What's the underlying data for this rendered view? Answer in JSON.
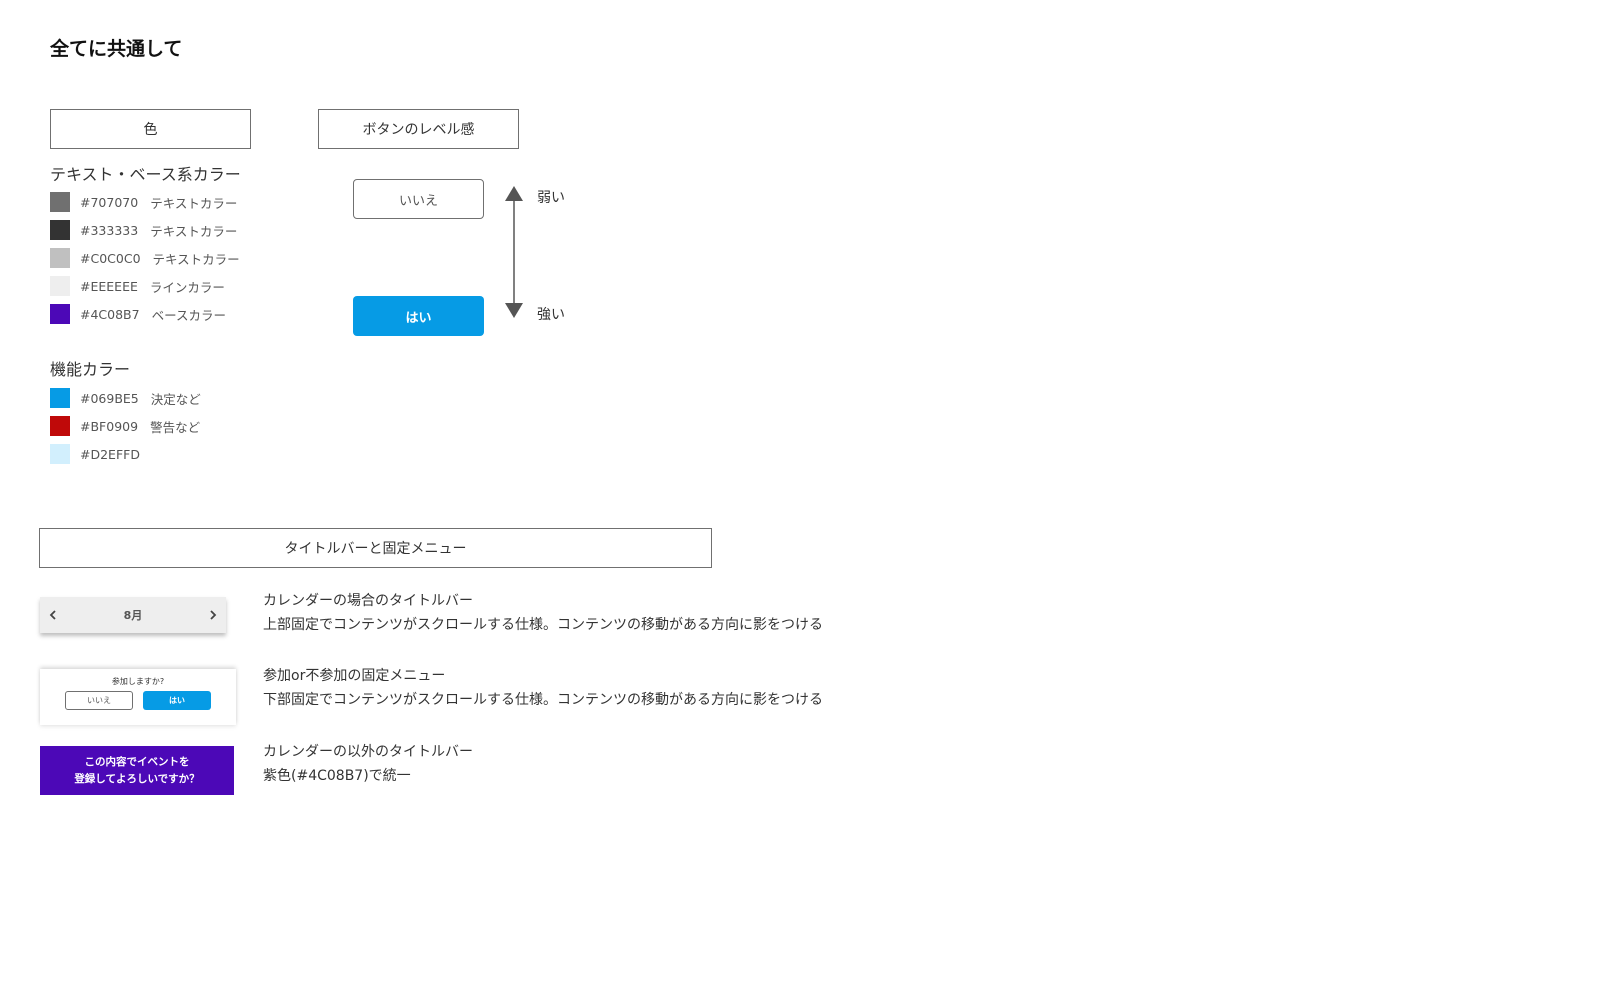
{
  "page_title": "全てに共通して",
  "color_section": {
    "heading": "色",
    "text_base_label": "テキスト・ベース系カラー",
    "text_base_colors": [
      {
        "hex": "#707070",
        "label": "テキストカラー"
      },
      {
        "hex": "#333333",
        "label": "テキストカラー"
      },
      {
        "hex": "#C0C0C0",
        "label": "テキストカラー"
      },
      {
        "hex": "#EEEEEE",
        "label": "ラインカラー"
      },
      {
        "hex": "#4C08B7",
        "label": "ベースカラー"
      }
    ],
    "function_label": "機能カラー",
    "function_colors": [
      {
        "hex": "#069BE5",
        "label": "決定など"
      },
      {
        "hex": "#BF0909",
        "label": "警告など"
      },
      {
        "hex": "#D2EFFD",
        "label": ""
      }
    ]
  },
  "button_section": {
    "heading": "ボタンのレベル感",
    "weak_button": "いいえ",
    "strong_button": "はい",
    "weak_label": "弱い",
    "strong_label": "強い",
    "accent_color": "#069BE5",
    "arrow_icon": "double-arrow-vertical-icon"
  },
  "titlebar_section": {
    "heading": "タイトルバーと固定メニュー",
    "calendar_bar": {
      "month": "8月",
      "prev_icon": "chevron-left-icon",
      "next_icon": "chevron-right-icon",
      "desc_title": "カレンダーの場合のタイトルバー",
      "desc_body": "上部固定でコンテンツがスクロールする仕様。コンテンツの移動がある方向に影をつける"
    },
    "fixed_menu": {
      "question": "参加しますか?",
      "no_label": "いいえ",
      "yes_label": "はい",
      "desc_title": "参加or不参加の固定メニュー",
      "desc_body": "下部固定でコンテンツがスクロールする仕様。コンテンツの移動がある方向に影をつける"
    },
    "other_bar": {
      "line1": "この内容でイベントを",
      "line2": "登録してよろしいですか？",
      "desc_title": "カレンダーの以外のタイトルバー",
      "desc_body": "紫色(#4C08B7)で統一"
    }
  }
}
